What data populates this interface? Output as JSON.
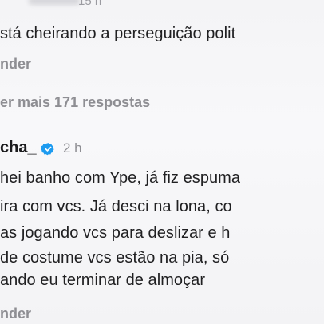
{
  "comment_1": {
    "timestamp": "15 h",
    "text": "stá cheirando a perseguição polit",
    "reply_label": "nder",
    "more_replies_label": "er mais 171 respostas"
  },
  "comment_2": {
    "username": "cha_",
    "verified_icon": "verified-badge-icon",
    "verified_color": "#1d9bf0",
    "timestamp": "2 h",
    "lines": [
      "hei banho com Ype, já fiz espuma",
      "ira com vcs. Já desci na lona, co",
      "as jogando vcs para deslizar e h",
      "de costume vcs estão na pia, só",
      "ando eu terminar de almoçar"
    ],
    "reply_label": "nder"
  }
}
